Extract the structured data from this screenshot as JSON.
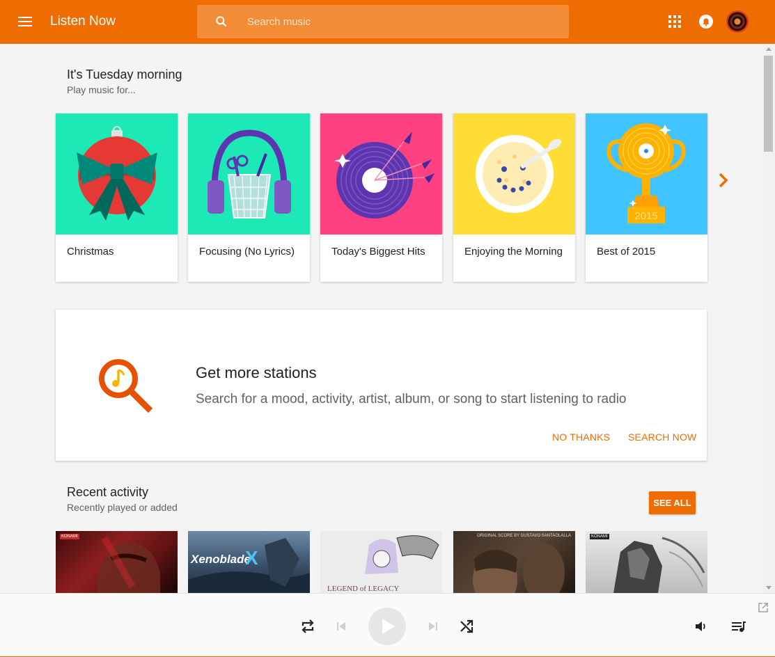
{
  "header": {
    "title": "Listen Now",
    "search_placeholder": "Search music"
  },
  "listen_now": {
    "title": "It's Tuesday morning",
    "subtitle": "Play music for..."
  },
  "cards": [
    {
      "label": "Christmas",
      "color": "#1de9b6"
    },
    {
      "label": "Focusing (No Lyrics)",
      "color": "#1de9b6"
    },
    {
      "label": "Today's Biggest Hits",
      "color": "#ff4081"
    },
    {
      "label": "Enjoying the Morning",
      "color": "#ffdd35"
    },
    {
      "label": "Best of 2015",
      "color": "#40c4ff"
    }
  ],
  "promo": {
    "title": "Get more stations",
    "text": "Search for a mood, activity, artist, album, or song to start listening to radio",
    "no_thanks": "NO THANKS",
    "search_now": "SEARCH NOW"
  },
  "recent": {
    "title": "Recent activity",
    "subtitle": "Recently played or added",
    "see_all": "SEE ALL",
    "albums": [
      {
        "tag": "KONAMI"
      },
      {
        "logo": "Xenoblade"
      },
      {
        "logo": "LEGEND of LEGACY"
      },
      {
        "caption": "ORIGINAL SCORE BY GUSTAVO SANTAOLALLA"
      },
      {
        "tag": "KONAMI"
      }
    ]
  },
  "card_art": {
    "best_of_year": "2015"
  },
  "colors": {
    "accent": "#ef6c00",
    "search_bg": "#f28c37"
  },
  "icons": {
    "menu": "menu-icon",
    "search": "search-icon",
    "apps": "apps-grid-icon",
    "notifications": "bell-icon",
    "repeat": "repeat-icon",
    "previous": "skip-previous-icon",
    "play": "play-icon",
    "next": "skip-next-icon",
    "shuffle": "shuffle-icon",
    "volume": "volume-icon",
    "queue": "queue-icon",
    "popout": "open-in-new-icon"
  }
}
